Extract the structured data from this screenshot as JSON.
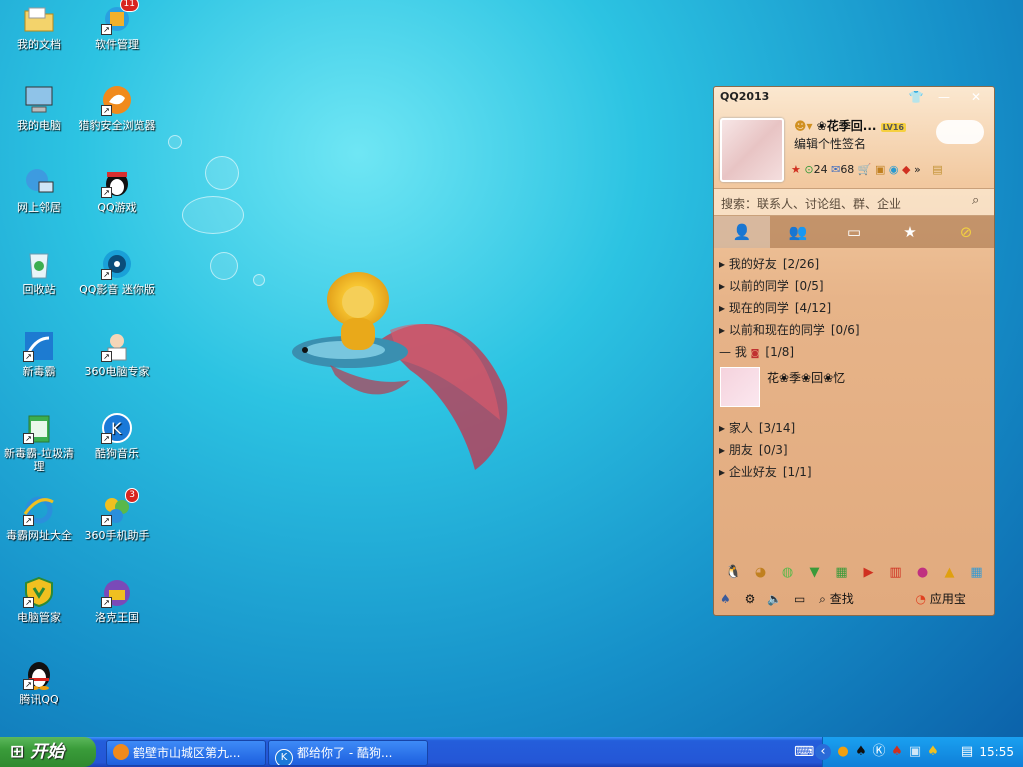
{
  "desktop": {
    "icons": [
      {
        "label": "我的文档",
        "icon": "folder-icon"
      },
      {
        "label": "软件管理",
        "icon": "software-manager-icon",
        "badge": "11"
      },
      {
        "label": "我的电脑",
        "icon": "computer-icon"
      },
      {
        "label": "猎豹安全浏览器",
        "icon": "browser-icon"
      },
      {
        "label": "网上邻居",
        "icon": "network-icon"
      },
      {
        "label": "QQ游戏",
        "icon": "qq-game-icon"
      },
      {
        "label": "回收站",
        "icon": "recycle-bin-icon"
      },
      {
        "label": "QQ影音 迷你版",
        "icon": "qq-player-icon"
      },
      {
        "label": "新毒霸",
        "icon": "antivirus-icon"
      },
      {
        "label": "360电脑专家",
        "icon": "360-expert-icon"
      },
      {
        "label": "新毒霸-垃圾清理",
        "icon": "trash-cleaner-icon"
      },
      {
        "label": "酷狗音乐",
        "icon": "kugou-icon"
      },
      {
        "label": "毒霸网址大全",
        "icon": "ie-icon"
      },
      {
        "label": "360手机助手",
        "icon": "360-phone-icon",
        "badge": "3"
      },
      {
        "label": "电脑管家",
        "icon": "pc-manager-icon"
      },
      {
        "label": "洛克王国",
        "icon": "roco-kingdom-icon"
      },
      {
        "label": "腾讯QQ",
        "icon": "qq-penguin-icon"
      }
    ]
  },
  "qq": {
    "title": "QQ2013",
    "nickname": "❀花季回...",
    "level_badge": "LV16",
    "signature": "编辑个性签名",
    "mail_count": "24",
    "msg_count": "68",
    "search_placeholder": "搜索：联系人、讨论组、群、企业",
    "tabs": [
      "contacts-tab-icon",
      "groups-tab-icon",
      "chat-tab-icon",
      "star-tab-icon",
      "zone-tab-icon"
    ],
    "groups": [
      {
        "name": "我的好友",
        "count": "[2/26]"
      },
      {
        "name": "以前的同学",
        "count": "[0/5]"
      },
      {
        "name": "现在的同学",
        "count": "[4/12]"
      },
      {
        "name": "以前和现在的同学",
        "count": "[0/6]"
      },
      {
        "name": "我",
        "count": "[1/8]"
      },
      {
        "name": "家人",
        "count": "[3/14]"
      },
      {
        "name": "朋友",
        "count": "[0/3]"
      },
      {
        "name": "企业好友",
        "count": "[1/1]"
      }
    ],
    "friend_name": "花❀季❀回❀忆",
    "find_label": "查找",
    "app_store_label": "应用宝"
  },
  "taskbar": {
    "start_label": "开始",
    "tasks": [
      "鹤壁市山城区第九...",
      "都给你了 - 酷狗..."
    ],
    "clock": "15:55"
  },
  "colors": {
    "desktop_bg": "#1a9fd6",
    "taskbar": "#245edb",
    "start": "#3a9c3a",
    "qq_panel": "#e7b489"
  }
}
